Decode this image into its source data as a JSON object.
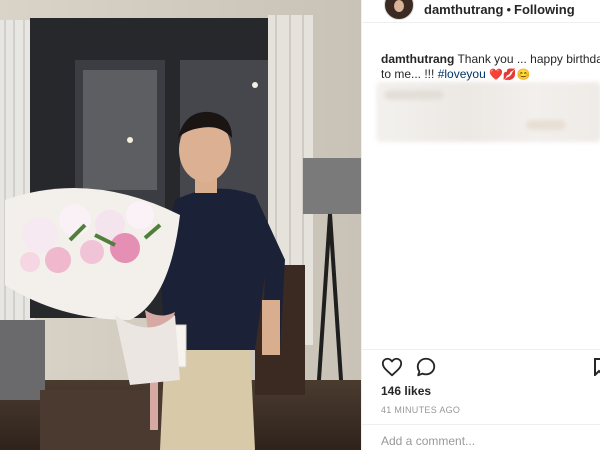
{
  "post_photo": {
    "description_icon": "photo"
  },
  "header": {
    "username": "damthutrang",
    "separator": "•",
    "follow_label": "Following"
  },
  "caption": {
    "username": "damthutrang",
    "text_line1": "Thank you ... happy birthday",
    "text_line2": "to me... !!!",
    "hashtag": "#loveyou",
    "emojis": "❤️💋😊"
  },
  "actions": {
    "like_icon": "heart-outline",
    "comment_icon": "speech-bubble",
    "save_icon": "bookmark"
  },
  "likes_text": "146 likes",
  "timestamp": "41 MINUTES AGO",
  "comment_box": {
    "placeholder": "Add a comment..."
  },
  "colors": {
    "hashtag": "#003569",
    "muted": "#999999",
    "text": "#262626"
  }
}
